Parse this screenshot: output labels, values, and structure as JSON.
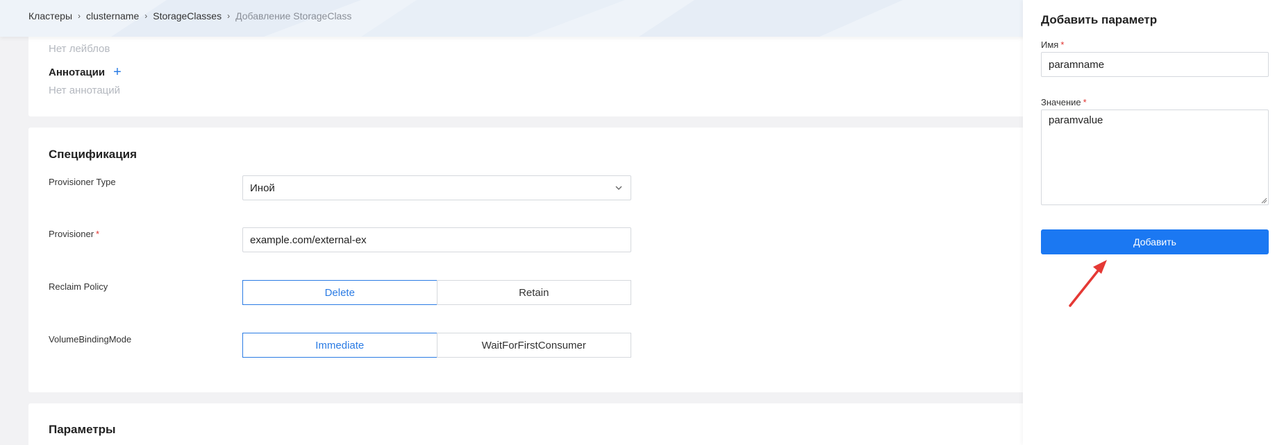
{
  "breadcrumb": [
    {
      "label": "Кластеры"
    },
    {
      "label": "clustername"
    },
    {
      "label": "StorageClasses"
    },
    {
      "label": "Добавление StorageClass"
    }
  ],
  "metadata": {
    "no_labels": "Нет лейблов",
    "annotations_title": "Аннотации",
    "add_symbol": "+",
    "no_annotations": "Нет аннотаций"
  },
  "spec": {
    "title": "Спецификация",
    "provisioner_type": {
      "label": "Provisioner Type",
      "value": "Иной"
    },
    "provisioner": {
      "label": "Provisioner",
      "required_mark": "*",
      "value": "example.com/external-ex"
    },
    "reclaim_policy": {
      "label": "Reclaim Policy",
      "options": [
        "Delete",
        "Retain"
      ],
      "selected": "Delete"
    },
    "volume_binding_mode": {
      "label": "VolumeBindingMode",
      "options": [
        "Immediate",
        "WaitForFirstConsumer"
      ],
      "selected": "Immediate"
    }
  },
  "params": {
    "title": "Параметры"
  },
  "panel": {
    "title": "Добавить параметр",
    "name_label": "Имя",
    "name_value": "paramname",
    "value_label": "Значение",
    "value_value": "paramvalue",
    "required_mark": "*",
    "submit": "Добавить"
  },
  "colors": {
    "accent": "#1b78f2",
    "required": "#e0332f",
    "arrow": "#e53935"
  }
}
